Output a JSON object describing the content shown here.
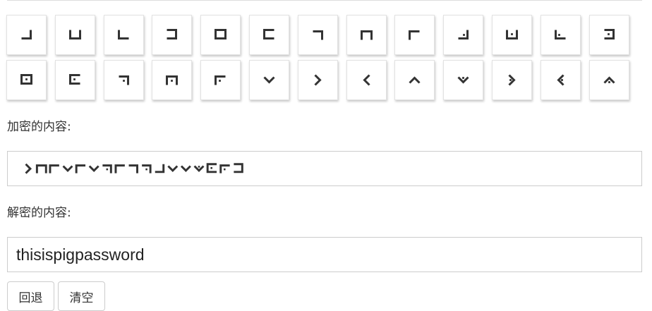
{
  "keyboard": {
    "row1": [
      {
        "key": "a",
        "icon": "pigpen-a-icon"
      },
      {
        "key": "b",
        "icon": "pigpen-b-icon"
      },
      {
        "key": "c",
        "icon": "pigpen-c-icon"
      },
      {
        "key": "d",
        "icon": "pigpen-d-icon"
      },
      {
        "key": "e",
        "icon": "pigpen-e-icon"
      },
      {
        "key": "f",
        "icon": "pigpen-f-icon"
      },
      {
        "key": "g",
        "icon": "pigpen-g-icon"
      },
      {
        "key": "h",
        "icon": "pigpen-h-icon"
      },
      {
        "key": "i",
        "icon": "pigpen-i-icon"
      },
      {
        "key": "j",
        "icon": "pigpen-j-icon"
      },
      {
        "key": "k",
        "icon": "pigpen-k-icon"
      },
      {
        "key": "l",
        "icon": "pigpen-l-icon"
      },
      {
        "key": "m",
        "icon": "pigpen-m-icon"
      }
    ],
    "row2": [
      {
        "key": "n",
        "icon": "pigpen-n-icon"
      },
      {
        "key": "o",
        "icon": "pigpen-o-icon"
      },
      {
        "key": "p",
        "icon": "pigpen-p-icon"
      },
      {
        "key": "q",
        "icon": "pigpen-q-icon"
      },
      {
        "key": "r",
        "icon": "pigpen-r-icon"
      },
      {
        "key": "s",
        "icon": "pigpen-s-icon"
      },
      {
        "key": "t",
        "icon": "pigpen-t-icon"
      },
      {
        "key": "u",
        "icon": "pigpen-u-icon"
      },
      {
        "key": "v",
        "icon": "pigpen-v-icon"
      },
      {
        "key": "w",
        "icon": "pigpen-w-icon"
      },
      {
        "key": "x",
        "icon": "pigpen-x-icon"
      },
      {
        "key": "y",
        "icon": "pigpen-y-icon"
      },
      {
        "key": "z",
        "icon": "pigpen-z-icon"
      }
    ]
  },
  "encrypted": {
    "label": "加密的内容:",
    "symbols": [
      "t",
      "h",
      "i",
      "s",
      "i",
      "s",
      "p",
      "i",
      "g",
      "p",
      "a",
      "s",
      "s",
      "w",
      "o",
      "r",
      "d"
    ]
  },
  "decrypted": {
    "label": "解密的内容:",
    "value": "thisispigpassword"
  },
  "buttons": {
    "back": "回退",
    "clear": "清空"
  }
}
